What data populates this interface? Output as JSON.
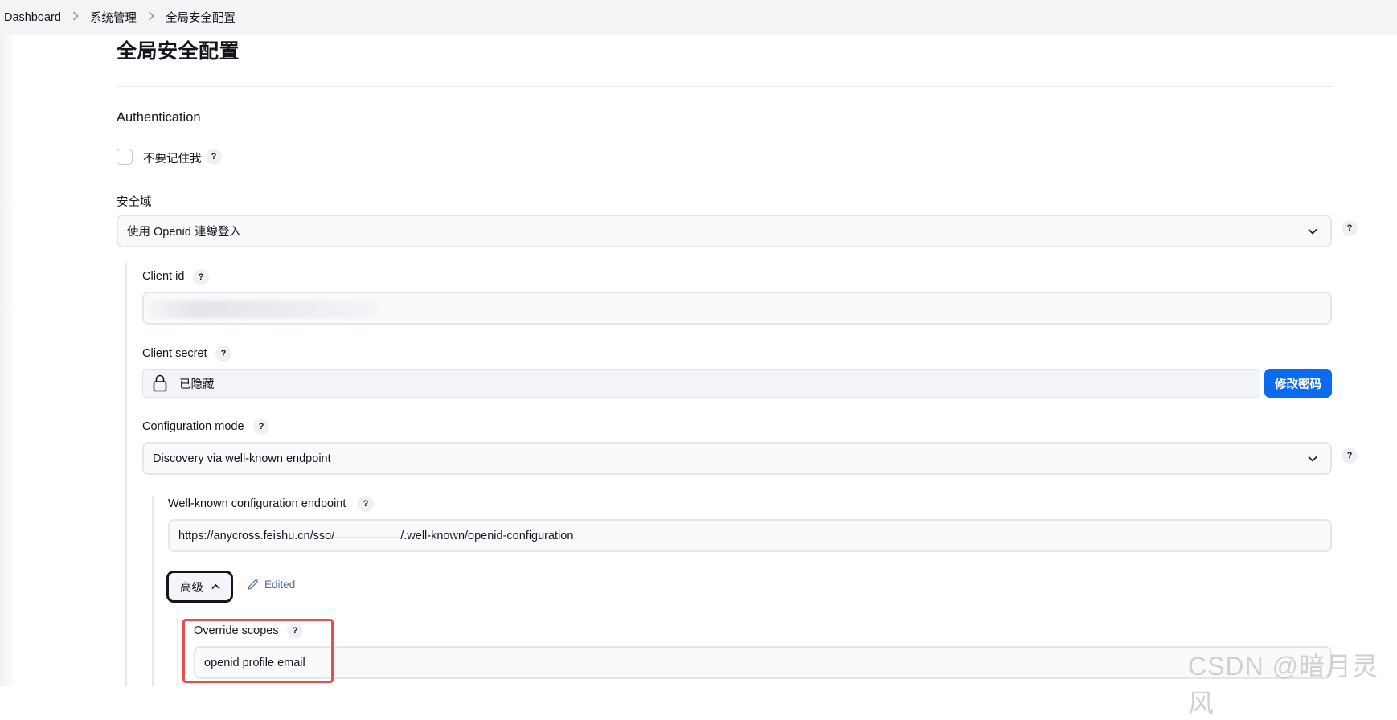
{
  "breadcrumb": {
    "items": [
      "Dashboard",
      "系统管理",
      "全局安全配置"
    ],
    "separator": ">"
  },
  "page": {
    "title": "全局安全配置"
  },
  "authentication": {
    "heading": "Authentication",
    "remember_me": {
      "label": "不要记住我",
      "checked": false
    }
  },
  "security_realm": {
    "label": "安全域",
    "selected": "使用 Openid 連線登入"
  },
  "client_id": {
    "label": "Client id",
    "value": ""
  },
  "client_secret": {
    "label": "Client secret",
    "value": "已隐藏",
    "button": "修改密码"
  },
  "configuration_mode": {
    "label": "Configuration mode",
    "selected": "Discovery via well-known endpoint"
  },
  "well_known": {
    "label": "Well-known configuration endpoint",
    "value_prefix": "https://anycross.feishu.cn/sso/",
    "value_suffix": "/.well-known/openid-configuration"
  },
  "advanced": {
    "button": "高级",
    "edited_label": "Edited"
  },
  "override_scopes": {
    "label": "Override scopes",
    "value": "openid profile email"
  },
  "help_glyph": "?",
  "watermark": "CSDN @暗月灵风",
  "colors": {
    "primary": "#0b6bef",
    "highlight": "#e5504f",
    "edited": "#4c6da8"
  },
  "icons": [
    "chevron-right-icon",
    "chevron-down-icon",
    "chevron-up-icon",
    "lock-icon",
    "pencil-icon"
  ]
}
